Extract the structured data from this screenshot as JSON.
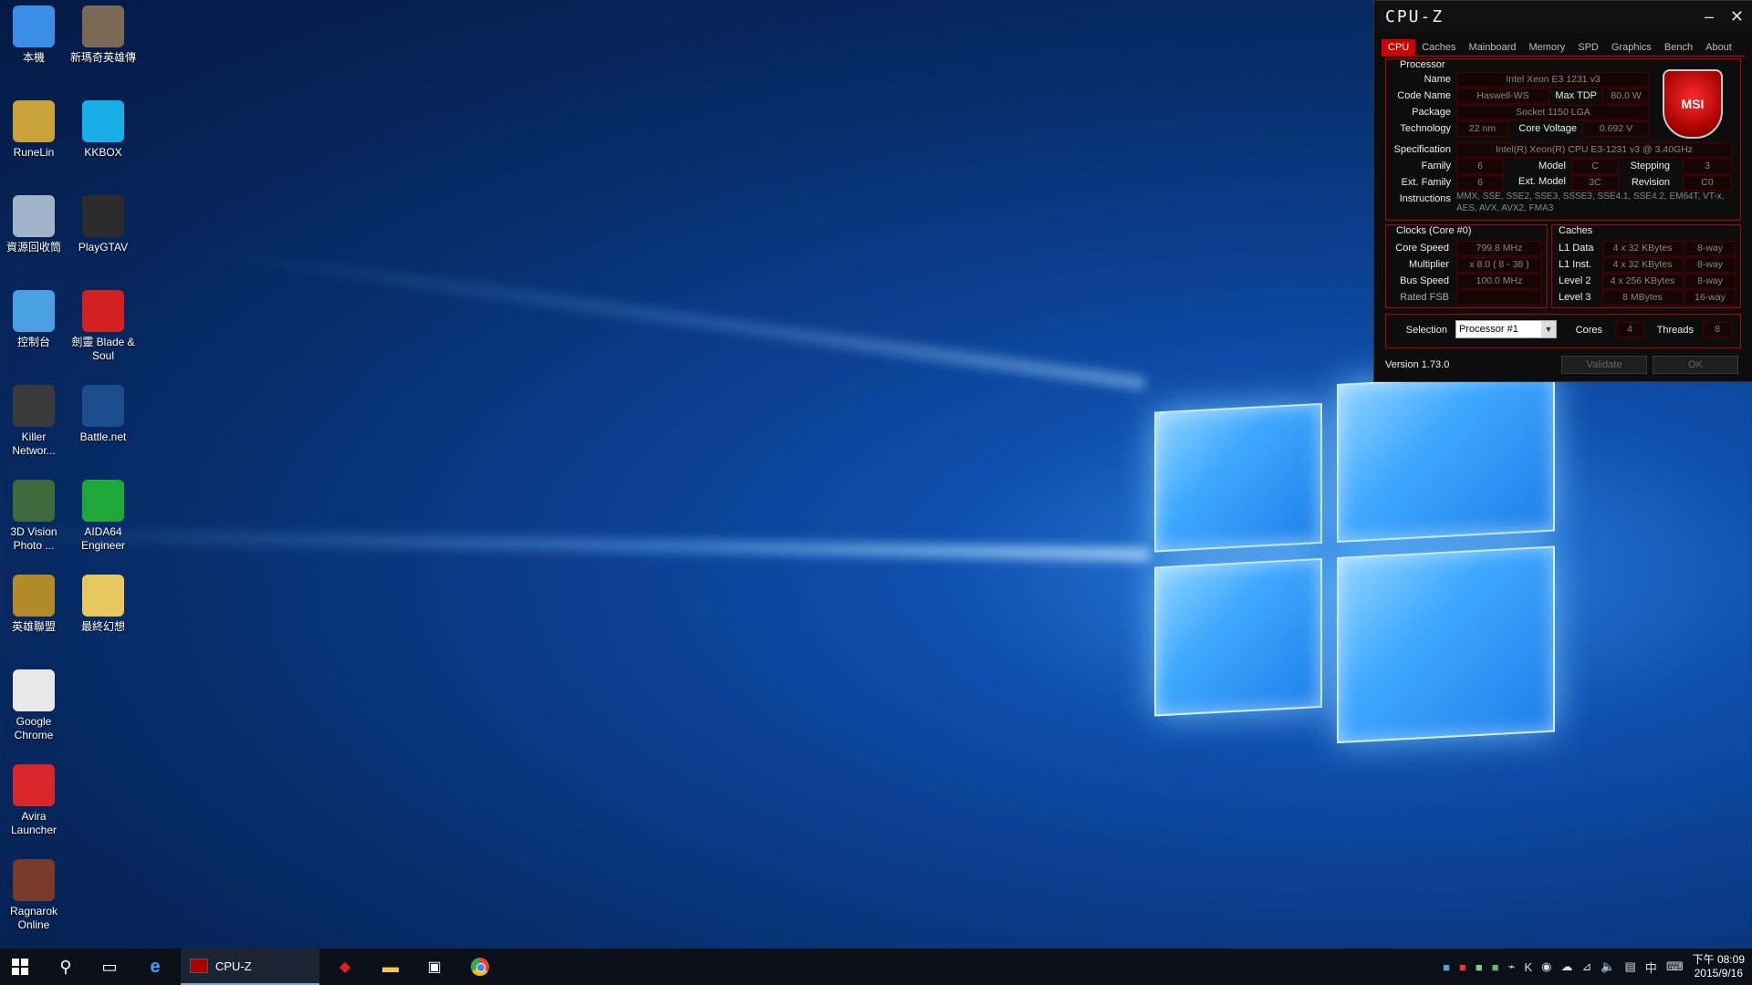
{
  "desktop": {
    "icons": [
      {
        "label": "本機",
        "icon": "computer-icon",
        "color": "#3a8ee6"
      },
      {
        "label": "新瑪奇英雄傳",
        "icon": "game-helmet-icon",
        "color": "#7a6a55"
      },
      {
        "label": "RuneLin",
        "icon": "user-folder-icon",
        "color": "#c9a23a"
      },
      {
        "label": "KKBOX",
        "icon": "kkbox-icon",
        "color": "#1aaee6"
      },
      {
        "label": "資源回收筒",
        "icon": "recycle-bin-icon",
        "color": "#9fb4c8"
      },
      {
        "label": "PlayGTAV",
        "icon": "gta-v-icon",
        "color": "#2c2c2c"
      },
      {
        "label": "控制台",
        "icon": "control-panel-icon",
        "color": "#4a9fe0"
      },
      {
        "label": "劍靈 Blade & Soul",
        "icon": "blade-soul-icon",
        "color": "#d42020"
      },
      {
        "label": "Killer Networ...",
        "icon": "killer-network-icon",
        "color": "#3a3a3a"
      },
      {
        "label": "Battle.net",
        "icon": "battlenet-icon",
        "color": "#1b4c8c"
      },
      {
        "label": "3D Vision Photo ...",
        "icon": "3d-vision-icon",
        "color": "#3c6a3c"
      },
      {
        "label": "AIDA64 Engineer",
        "icon": "aida64-icon",
        "color": "#1fa83a"
      },
      {
        "label": "英雄聯盟",
        "icon": "league-of-legends-icon",
        "color": "#b38a2a"
      },
      {
        "label": "最終幻想",
        "icon": "folder-icon",
        "color": "#e8c760"
      },
      {
        "label": "Google Chrome",
        "icon": "chrome-icon",
        "color": "#e8e8e8"
      },
      {
        "label": "Avira Launcher",
        "icon": "avira-icon",
        "color": "#d8262b"
      },
      {
        "label": "Ragnarok Online",
        "icon": "ragnarok-icon",
        "color": "#7a3a2a"
      }
    ]
  },
  "cpuz": {
    "title": "CPU-Z",
    "tabs": [
      "CPU",
      "Caches",
      "Mainboard",
      "Memory",
      "SPD",
      "Graphics",
      "Bench",
      "About"
    ],
    "active_tab": "CPU",
    "processor": {
      "section": "Processor",
      "name_label": "Name",
      "name": "Intel Xeon E3 1231 v3",
      "codename_label": "Code Name",
      "codename": "Haswell-WS",
      "maxtdp_label": "Max TDP",
      "maxtdp": "80.0 W",
      "package_label": "Package",
      "package": "Socket 1150 LGA",
      "technology_label": "Technology",
      "technology": "22 nm",
      "corevoltage_label": "Core Voltage",
      "corevoltage": "0.692 V",
      "spec_label": "Specification",
      "spec": "Intel(R) Xeon(R) CPU E3-1231 v3 @ 3.40GHz",
      "family_label": "Family",
      "family": "6",
      "model_label": "Model",
      "model": "C",
      "stepping_label": "Stepping",
      "stepping": "3",
      "extfamily_label": "Ext. Family",
      "extfamily": "6",
      "extmodel_label": "Ext. Model",
      "extmodel": "3C",
      "revision_label": "Revision",
      "revision": "C0",
      "instructions_label": "Instructions",
      "instructions": "MMX, SSE, SSE2, SSE3, SSSE3, SSE4.1, SSE4.2, EM64T, VT-x, AES, AVX, AVX2, FMA3"
    },
    "clocks": {
      "section": "Clocks (Core #0)",
      "corespeed_label": "Core Speed",
      "corespeed": "799.8 MHz",
      "multiplier_label": "Multiplier",
      "multiplier": "x 8.0 ( 8 - 38 )",
      "busspeed_label": "Bus Speed",
      "busspeed": "100.0 MHz",
      "ratedfsb_label": "Rated FSB",
      "ratedfsb": ""
    },
    "caches": {
      "section": "Caches",
      "l1data_label": "L1 Data",
      "l1data": "4 x 32 KBytes",
      "l1data_way": "8-way",
      "l1inst_label": "L1 Inst.",
      "l1inst": "4 x 32 KBytes",
      "l1inst_way": "8-way",
      "l2_label": "Level 2",
      "l2": "4 x 256 KBytes",
      "l2_way": "8-way",
      "l3_label": "Level 3",
      "l3": "8 MBytes",
      "l3_way": "16-way"
    },
    "selection_label": "Selection",
    "selection": "Processor #1",
    "cores_label": "Cores",
    "cores": "4",
    "threads_label": "Threads",
    "threads": "8",
    "version": "Version 1.73.0",
    "validate_label": "Validate",
    "ok_label": "OK",
    "brand_color": "#d10000"
  },
  "taskbar": {
    "active_app_label": "CPU-Z",
    "clock_period": "下午 08:09",
    "date": "2015/9/16",
    "ime_label": "中"
  }
}
